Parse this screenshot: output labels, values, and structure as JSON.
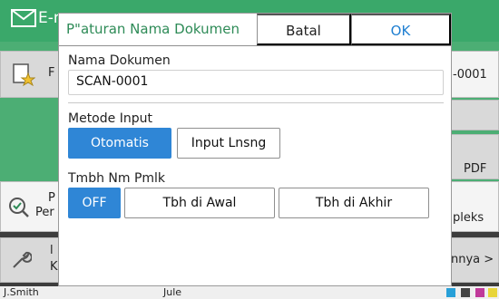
{
  "background": {
    "header_title": "E-m",
    "tiles": {
      "fav_letter": "F",
      "filename_tail": "-0001",
      "format": "PDF",
      "preview_p": "P",
      "preview_label": "Per",
      "sided": "pleks",
      "tools_letter": "l",
      "tools_k": "K",
      "more": "nnya >"
    },
    "status_bar": {
      "user": "J.Smith",
      "date": "Jule"
    }
  },
  "dialog": {
    "title": "P\"aturan Nama Dokumen",
    "cancel_label": "Batal",
    "ok_label": "OK",
    "name_label": "Nama Dokumen",
    "name_value": "SCAN-0001",
    "input_method_label": "Metode Input",
    "input_method_options": [
      "Otomatis",
      "Input Lnsng"
    ],
    "input_method_selected": "Otomatis",
    "suffix_label": "Tmbh Nm Pmlk",
    "suffix_options": [
      "OFF",
      "Tbh di Awal",
      "Tbh di Akhir"
    ],
    "suffix_selected": "OFF"
  },
  "colors": {
    "header_green": "#3aa86a",
    "title_green": "#2e8b57",
    "ok_blue": "#1f7fd1",
    "selected_blue": "#2f86d6"
  }
}
